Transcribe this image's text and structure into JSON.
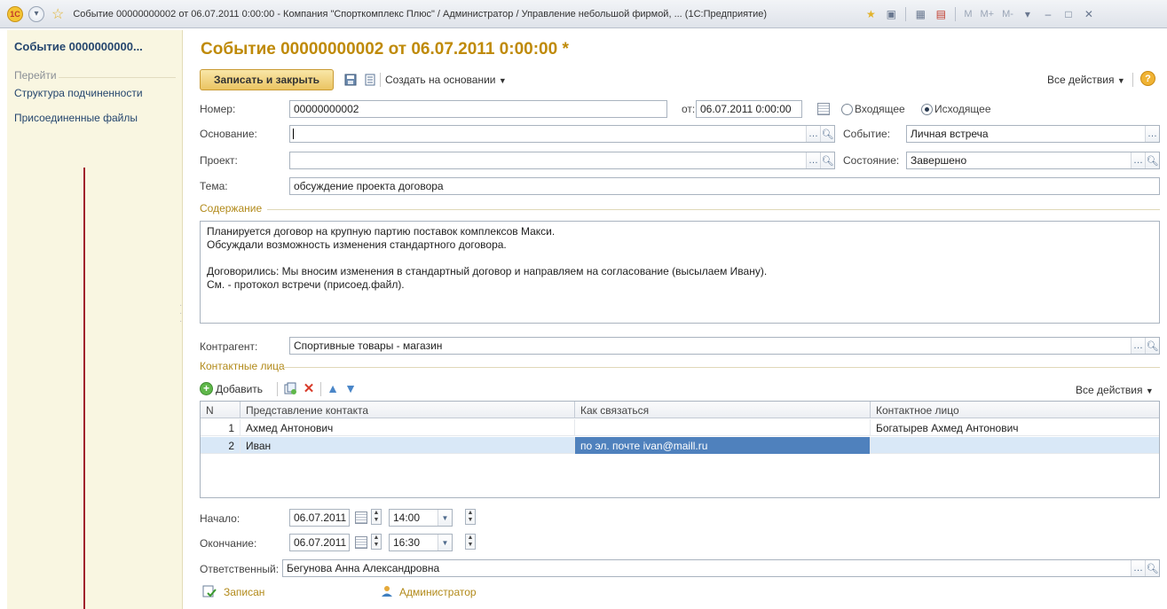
{
  "window": {
    "title": "Событие 00000000002 от 06.07.2011 0:00:00 - Компания \"Спорткомплекс Плюс\" / Администратор / Управление небольшой фирмой, ... (1С:Предприятие)",
    "logo_text": "1С",
    "m_buttons": [
      "M",
      "M+",
      "M-"
    ]
  },
  "sidebar": {
    "title": "Событие 0000000000...",
    "section": "Перейти",
    "links": [
      "Структура подчиненности",
      "Присоединенные файлы"
    ]
  },
  "header": {
    "title": "Событие 00000000002 от 06.07.2011 0:00:00 *"
  },
  "toolbar": {
    "save_close": "Записать и закрыть",
    "create_based": "Создать на основании",
    "all_actions": "Все действия"
  },
  "form": {
    "number_label": "Номер:",
    "number_value": "00000000002",
    "date_label": "от:",
    "date_value": "06.07.2011  0:00:00",
    "radio_incoming": "Входящее",
    "radio_outgoing": "Исходящее",
    "basis_label": "Основание:",
    "basis_value": "",
    "event_label": "Событие:",
    "event_value": "Личная встреча",
    "project_label": "Проект:",
    "project_value": "",
    "state_label": "Состояние:",
    "state_value": "Завершено",
    "topic_label": "Тема:",
    "topic_value": "обсуждение проекта договора",
    "content_label": "Содержание",
    "content_lines": [
      "Планируется договор на крупную партию поставок комплексов Макси.",
      "Обсуждали возможность изменения стандартного договора.",
      "",
      "Договорились: Мы вносим изменения в стандартный договор и направляем на согласование (высылаем Ивану).",
      "См. - протокол встречи (присоед.файл)."
    ],
    "counterparty_label": "Контрагент:",
    "counterparty_value": "Спортивные товары - магазин",
    "contacts_label": "Контактные лица",
    "add_label": "Добавить",
    "contacts_all_actions": "Все действия",
    "start_label": "Начало:",
    "start_date": "06.07.2011",
    "start_time": "14:00",
    "end_label": "Окончание:",
    "end_date": "06.07.2011",
    "end_time": "16:30",
    "responsible_label": "Ответственный:",
    "responsible_value": "Бегунова Анна Александровна",
    "status_text": "Записан",
    "author_text": "Администратор"
  },
  "contacts_table": {
    "columns": [
      "N",
      "Представление контакта",
      "Как связаться",
      "Контактное лицо"
    ],
    "rows": [
      {
        "n": "1",
        "contact": "Ахмед Антонович",
        "how": "",
        "person": "Богатырев Ахмед Антонович"
      },
      {
        "n": "2",
        "contact": "Иван",
        "how": "по эл. почте ivan@maill.ru",
        "person": ""
      }
    ]
  },
  "colors": {
    "title_gold": "#bf8a08",
    "sidebar_bg": "#f9f6e1",
    "selection": "#4f81bd"
  }
}
